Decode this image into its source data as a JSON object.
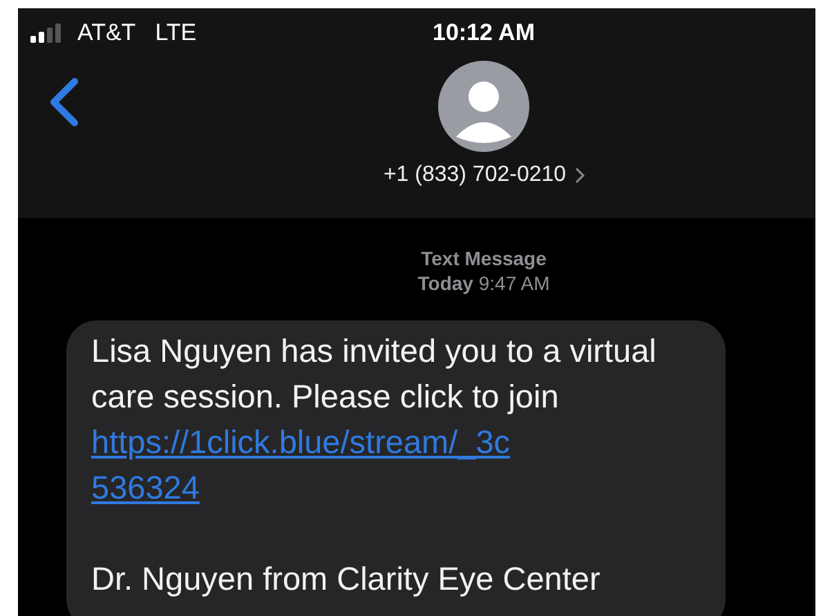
{
  "status_bar": {
    "carrier": "AT&T",
    "network": "LTE",
    "time": "10:12 AM"
  },
  "contact": {
    "phone": "+1 (833) 702-0210"
  },
  "thread_header": {
    "service": "Text Message",
    "day": "Today",
    "time": "9:47 AM"
  },
  "message": {
    "text": "Lisa Nguyen has invited you to a virtual care session. Please click to join",
    "link": "https://1click.blue/stream/_3c536324",
    "signature": "Dr. Nguyen from Clarity Eye Center"
  }
}
